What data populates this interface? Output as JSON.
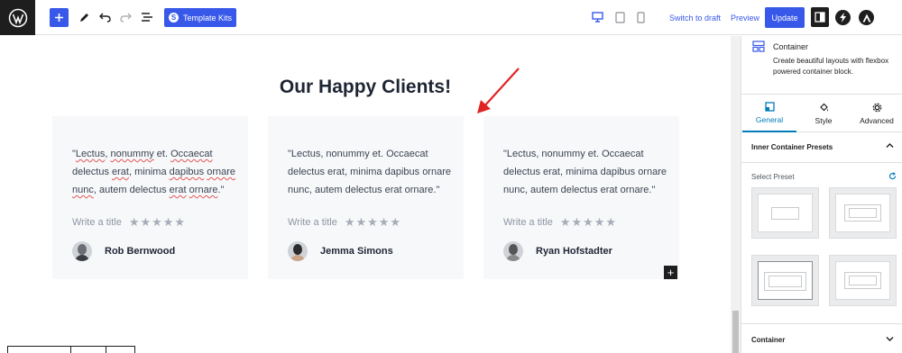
{
  "toolbar": {
    "template_kits_label": "Template Kits",
    "switch_draft_label": "Switch to draft",
    "preview_label": "Preview",
    "update_label": "Update",
    "icons": [
      "wordpress-logo-icon",
      "add-block-icon",
      "edit-pencil-icon",
      "undo-icon",
      "redo-icon",
      "list-view-icon",
      "desktop-icon",
      "tablet-icon",
      "mobile-icon",
      "settings-icon",
      "bolt-icon",
      "astra-icon"
    ]
  },
  "content": {
    "heading": "Our Happy Clients!",
    "cards": [
      {
        "quote_parts": [
          "\"",
          "Lectus",
          ", ",
          "nonummy",
          " et. ",
          "Occaecat",
          " delectus ",
          "erat",
          ", minima ",
          "dapibus",
          " ",
          "ornare",
          " ",
          "nunc",
          ", autem delectus ",
          "erat",
          " ",
          "ornare",
          ".\""
        ],
        "rating_label": "Write a title",
        "stars": "★★★★★",
        "author": "Rob Bernwood"
      },
      {
        "quote": "\"Lectus, nonummy et. Occaecat delectus erat, minima dapibus ornare nunc, autem delectus erat ornare.\"",
        "rating_label": "Write a title",
        "stars": "★★★★★",
        "author": "Jemma Simons"
      },
      {
        "quote": "\"Lectus, nonummy et. Occaecat delectus erat, minima dapibus ornare nunc, autem delectus erat ornare.\"",
        "rating_label": "Write a title",
        "stars": "★★★★★",
        "author": "Ryan Hofstadter"
      }
    ],
    "add_block_glyph": "+"
  },
  "sidebar": {
    "block_name": "Container",
    "block_description": "Create beautiful layouts with flexbox powered container block.",
    "tabs": [
      {
        "label": "General"
      },
      {
        "label": "Style"
      },
      {
        "label": "Advanced"
      }
    ],
    "inner_presets_title": "Inner Container Presets",
    "select_preset_label": "Select Preset",
    "container_section_title": "Container"
  },
  "colors": {
    "accent": "#3858e9",
    "arrow": "#e02424",
    "active_tab": "#007cba"
  }
}
